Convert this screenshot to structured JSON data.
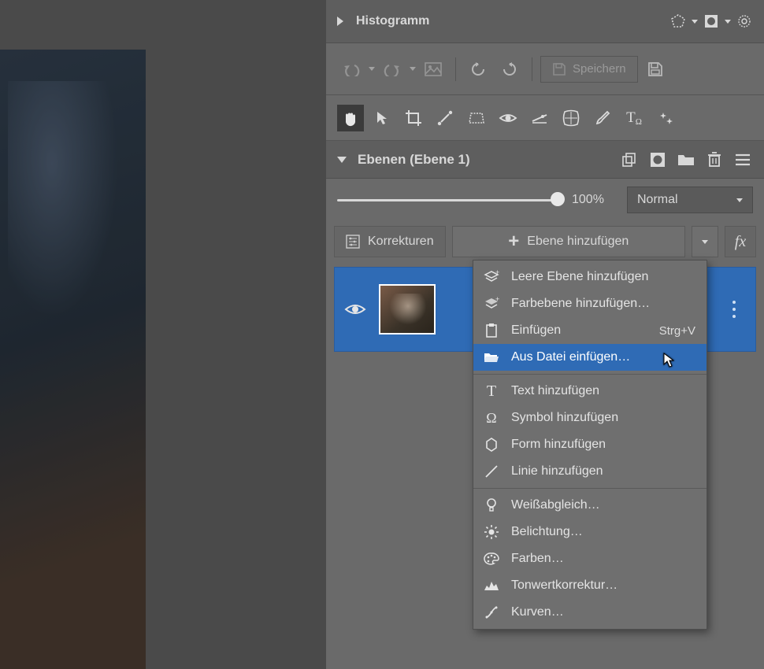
{
  "histogram": {
    "title": "Histogramm"
  },
  "toolbar": {
    "save_label": "Speichern"
  },
  "layers": {
    "panel_title": "Ebenen (Ebene 1)",
    "opacity_label": "100%",
    "blend_mode": "Normal",
    "corrections_label": "Korrekturen",
    "addlayer_label": "Ebene hinzufügen",
    "fx_label": "fx"
  },
  "menu": {
    "items": [
      {
        "label": "Leere Ebene hinzufügen",
        "shortcut": ""
      },
      {
        "label": "Farbebene hinzufügen…",
        "shortcut": ""
      },
      {
        "label": "Einfügen",
        "shortcut": "Strg+V"
      },
      {
        "label": "Aus Datei einfügen…",
        "shortcut": ""
      },
      {
        "label": "Text hinzufügen",
        "shortcut": ""
      },
      {
        "label": "Symbol hinzufügen",
        "shortcut": ""
      },
      {
        "label": "Form hinzufügen",
        "shortcut": ""
      },
      {
        "label": "Linie hinzufügen",
        "shortcut": ""
      },
      {
        "label": "Weißabgleich…",
        "shortcut": ""
      },
      {
        "label": "Belichtung…",
        "shortcut": ""
      },
      {
        "label": "Farben…",
        "shortcut": ""
      },
      {
        "label": "Tonwertkorrektur…",
        "shortcut": ""
      },
      {
        "label": "Kurven…",
        "shortcut": ""
      }
    ]
  }
}
